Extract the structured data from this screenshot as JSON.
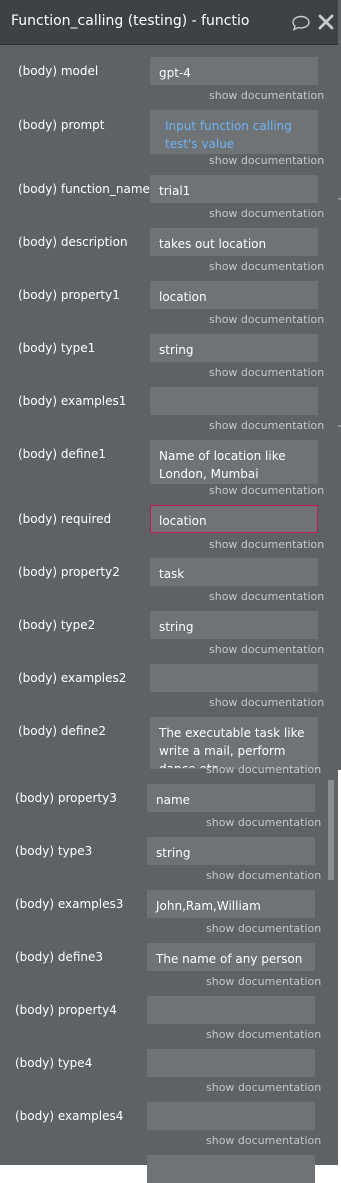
{
  "window": {
    "title": "Function_calling (testing) - functio",
    "chat_icon": "speech-bubble-icon",
    "close_icon": "close-icon"
  },
  "doc_link": "show documentation",
  "fields": [
    {
      "label": "(body) model",
      "value": "gpt-4"
    },
    {
      "label": "(body) prompt",
      "value": "Input function calling test's value",
      "dynamic": true
    },
    {
      "label": "(body) function_name",
      "value": "trial1"
    },
    {
      "label": "(body) description",
      "value": "takes out location"
    },
    {
      "label": "(body) property1",
      "value": "location"
    },
    {
      "label": "(body) type1",
      "value": "string"
    },
    {
      "label": "(body) examples1",
      "value": ""
    },
    {
      "label": "(body) define1",
      "value": "Name of location like London, Mumbai"
    },
    {
      "label": "(body) required",
      "value": "location",
      "focused": true
    },
    {
      "label": "(body) property2",
      "value": "task"
    },
    {
      "label": "(body) type2",
      "value": "string"
    },
    {
      "label": "(body) examples2",
      "value": ""
    },
    {
      "label": "(body) define2",
      "value": "The executable task like write a mail, perform dance etc"
    },
    {
      "label": "(body) property3",
      "value": "name"
    },
    {
      "label": "(body) type3",
      "value": "string"
    },
    {
      "label": "(body) examples3",
      "value": "John,Ram,William"
    },
    {
      "label": "(body) define3",
      "value": "The name of any person"
    },
    {
      "label": "(body) property4",
      "value": ""
    },
    {
      "label": "(body) type4",
      "value": ""
    },
    {
      "label": "(body) examples4",
      "value": ""
    }
  ]
}
